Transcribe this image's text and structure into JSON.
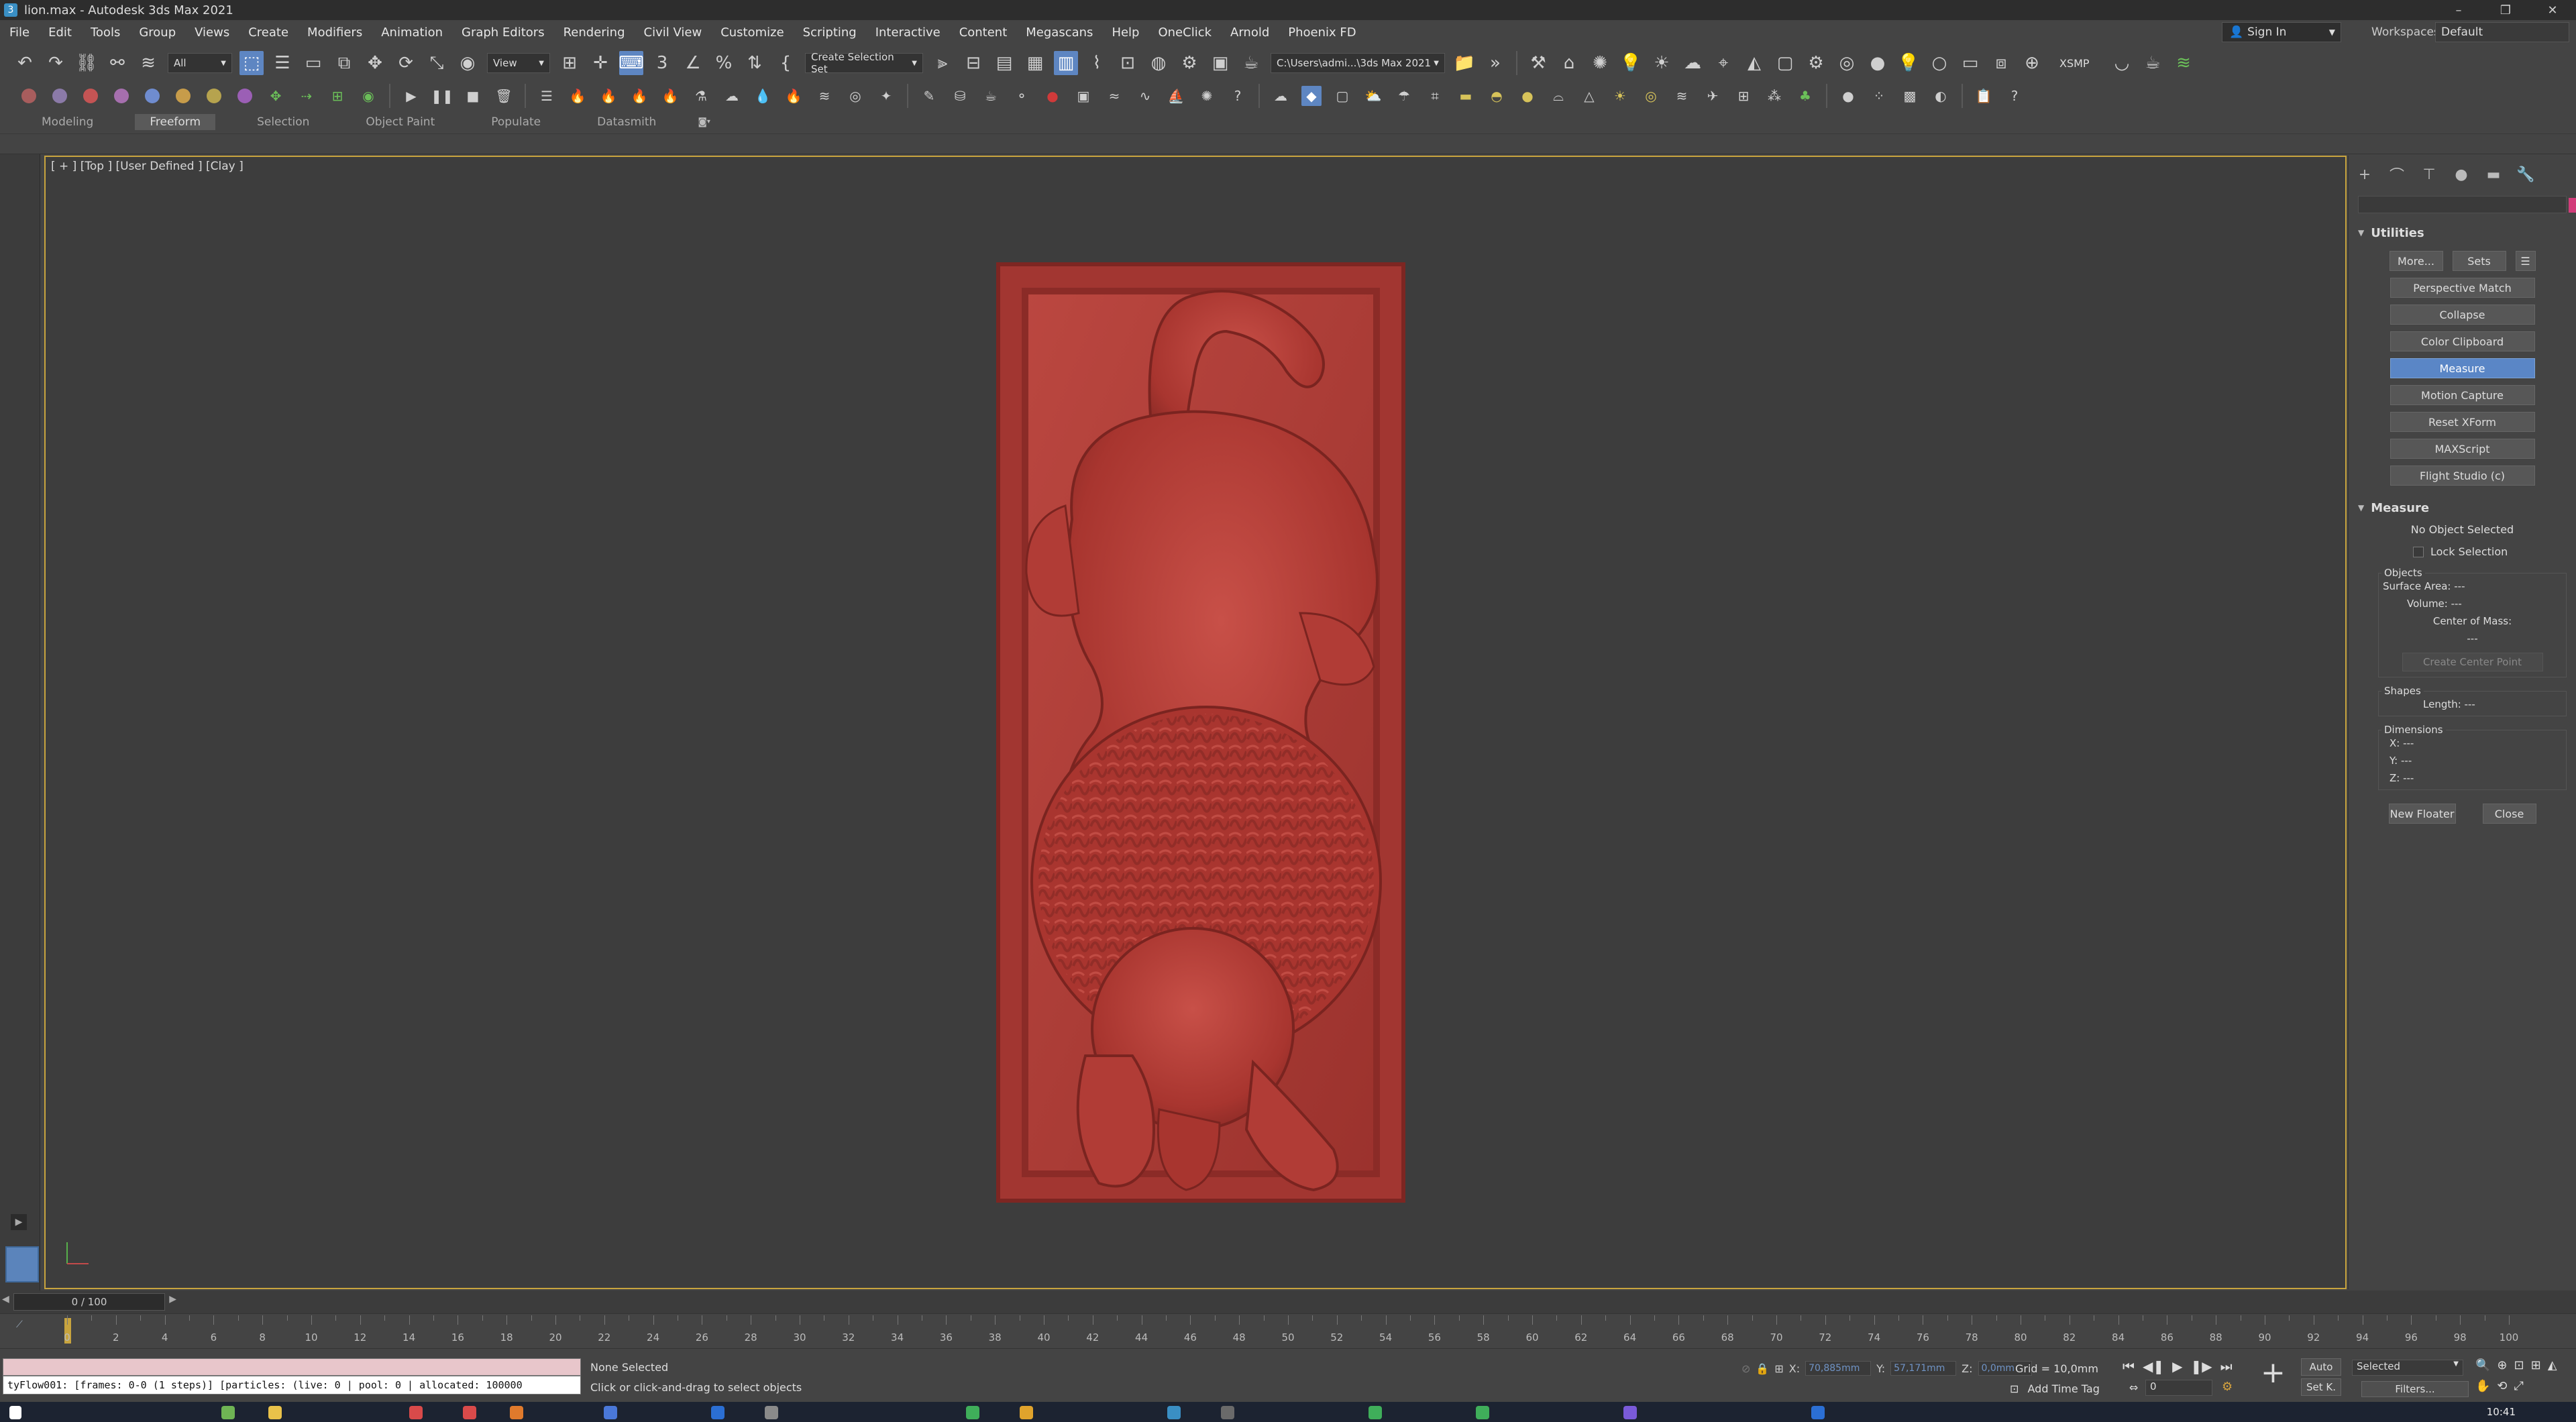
{
  "window": {
    "title": "lion.max - Autodesk 3ds Max 2021",
    "minimize": "–",
    "restore": "❐",
    "close": "✕"
  },
  "menubar": {
    "items": [
      "File",
      "Edit",
      "Tools",
      "Group",
      "Views",
      "Create",
      "Modifiers",
      "Animation",
      "Graph Editors",
      "Rendering",
      "Civil View",
      "Customize",
      "Scripting",
      "Interactive",
      "Content",
      "Megascans",
      "Help",
      "OneClick",
      "Arnold",
      "Phoenix FD"
    ],
    "signin": "Sign In",
    "workspaces_label": "Workspaces:",
    "workspaces_value": "Default"
  },
  "toolbar": {
    "selection_filter": "All",
    "ref_coord": "View",
    "named_selection": "Create Selection Set",
    "project_path": "C:\\Users\\admi...\\3ds Max 2021",
    "xsmp": "XSMP"
  },
  "ribbon": {
    "tabs": [
      "Modeling",
      "Freeform",
      "Selection",
      "Object Paint",
      "Populate",
      "Datasmith"
    ],
    "active": "Freeform"
  },
  "viewport": {
    "label": "[ + ] [Top ] [User Defined ] [Clay ]",
    "model_color": "#b23a34"
  },
  "command_panel": {
    "utilities_title": "Utilities",
    "more_button": "More...",
    "sets_button": "Sets",
    "utility_buttons": [
      "Perspective Match",
      "Collapse",
      "Color Clipboard",
      "Measure",
      "Motion Capture",
      "Reset XForm",
      "MAXScript",
      "Flight Studio (c)"
    ],
    "selected_utility": "Measure",
    "measure": {
      "title": "Measure",
      "status": "No Object Selected",
      "lock_selection": "Lock Selection",
      "objects_group": "Objects",
      "surface_area": "Surface Area: ---",
      "volume": "Volume: ---",
      "center_of_mass": "Center of Mass:",
      "center_value": "---",
      "create_center_point": "Create Center Point",
      "shapes_group": "Shapes",
      "length": "Length: ---",
      "dimensions_group": "Dimensions",
      "x": "X: ---",
      "y": "Y: ---",
      "z": "Z: ---"
    },
    "new_floater": "New Floater",
    "close": "Close"
  },
  "timeline": {
    "frame_display": "0 / 100",
    "ticks": [
      "0",
      "2",
      "4",
      "6",
      "8",
      "10",
      "12",
      "14",
      "16",
      "18",
      "20",
      "22",
      "24",
      "26",
      "28",
      "30",
      "32",
      "34",
      "36",
      "38",
      "40",
      "42",
      "44",
      "46",
      "48",
      "50",
      "52",
      "54",
      "56",
      "58",
      "60",
      "62",
      "64",
      "66",
      "68",
      "70",
      "72",
      "74",
      "76",
      "78",
      "80",
      "82",
      "84",
      "86",
      "88",
      "90",
      "92",
      "94",
      "96",
      "98",
      "100"
    ]
  },
  "status": {
    "maxscript_output": "tyFlow001: [frames: 0-0 (1 steps)] [particles: (live: 0 | pool: 0 | allocated: 100000",
    "selection": "None Selected",
    "prompt": "Click or click-and-drag to select objects",
    "x_label": "X:",
    "x_value": "70,885mm",
    "y_label": "Y:",
    "y_value": "57,171mm",
    "z_label": "Z:",
    "z_value": "0,0mm",
    "grid": "Grid = 10,0mm",
    "add_time_tag": "Add Time Tag",
    "auto_key": "Auto",
    "set_key": "Set K.",
    "key_mode": "Selected",
    "filters": "Filters...",
    "current_frame": "0",
    "clock": "10:41"
  }
}
